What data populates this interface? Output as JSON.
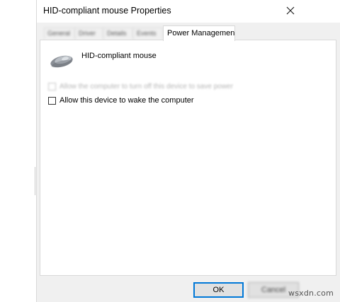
{
  "window": {
    "title": "HID-compliant mouse Properties"
  },
  "tabs": [
    {
      "label": "General"
    },
    {
      "label": "Driver"
    },
    {
      "label": "Details"
    },
    {
      "label": "Events"
    },
    {
      "label": "Power Management",
      "active": true
    }
  ],
  "device": {
    "name": "HID-compliant mouse",
    "icon": "mouse-icon"
  },
  "options": [
    {
      "label": "Allow the computer to turn off this device to save power",
      "checked": false,
      "blurred": true
    },
    {
      "label": "Allow this device to wake the computer",
      "checked": false
    }
  ],
  "buttons": {
    "ok": "OK",
    "cancel": "Cancel"
  },
  "watermark": "wsxdn.com",
  "colors": {
    "accent": "#0078d7",
    "dialog_bg": "#f0f0f0",
    "panel_bg": "#ffffff"
  }
}
